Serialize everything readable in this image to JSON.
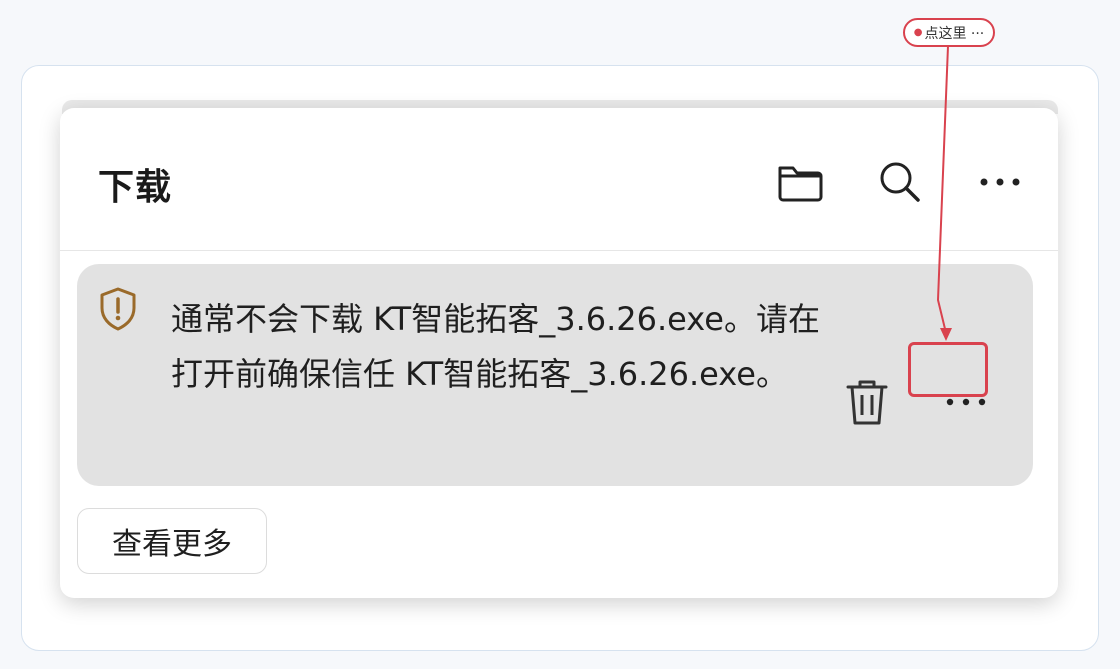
{
  "downloads_panel": {
    "title": "下载",
    "header_icons": [
      "folder-icon",
      "search-icon",
      "more-options-icon"
    ]
  },
  "download_item": {
    "message": "通常不会下载 KT智能拓客_3.6.26.exe。请在打开前确保信任 KT智能拓客_3.6.26.exe。",
    "icons": [
      "shield-warning-icon",
      "trash-icon",
      "more-options-icon"
    ]
  },
  "view_more_label": "查看更多",
  "annotation": {
    "callout_label": "点这里 ···",
    "color": "#d9424e"
  },
  "colors": {
    "warning_icon": "#9a6a2a",
    "item_background": "#e2e2e2",
    "annotation": "#d9424e"
  }
}
